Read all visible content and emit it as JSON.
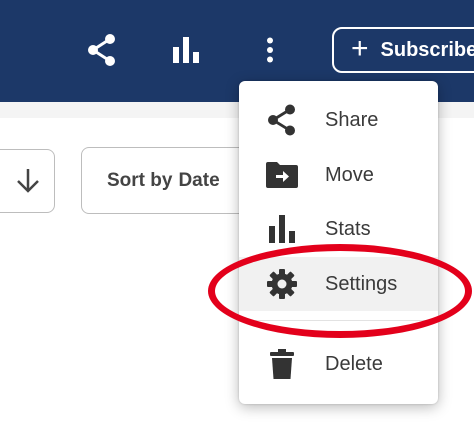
{
  "header": {
    "background": "#1c3868",
    "icons": [
      "share-icon",
      "stats-icon",
      "more-vertical-icon"
    ],
    "subscribe_label": "Subscribe"
  },
  "toolbar": {
    "sort_direction_icon": "arrow-down-icon",
    "sort_prefix": "Sort by",
    "sort_value": "Date"
  },
  "menu": {
    "items": [
      {
        "label": "Share",
        "icon": "share-icon"
      },
      {
        "label": "Move",
        "icon": "move-folder-icon"
      },
      {
        "label": "Stats",
        "icon": "stats-icon"
      },
      {
        "label": "Settings",
        "icon": "gear-icon",
        "highlighted": true
      },
      {
        "label": "Delete",
        "icon": "trash-icon"
      }
    ]
  },
  "annotation": {
    "color": "#e3001b",
    "target": "Settings"
  }
}
